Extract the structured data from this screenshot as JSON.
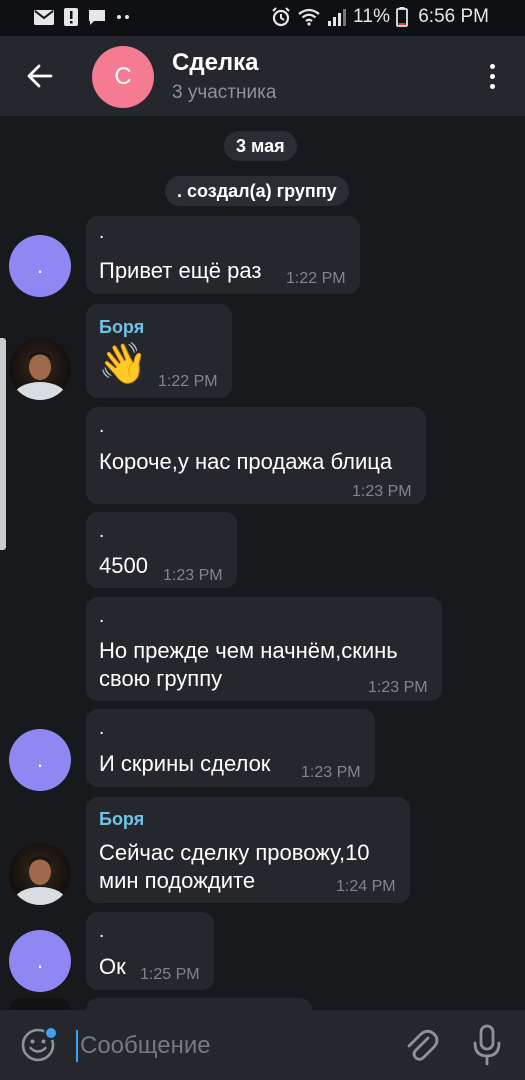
{
  "status_bar": {
    "battery": "11%",
    "time": "6:56 PM",
    "icons_left": [
      "mail-icon",
      "alert-icon",
      "chat-icon",
      "more-icon"
    ],
    "icons_right": [
      "alarm-icon",
      "wifi-icon",
      "signal-icon",
      "battery-icon"
    ]
  },
  "header": {
    "avatar_letter": "С",
    "title": "Сделка",
    "subtitle": "3 участника",
    "avatar_color": "#f47b91"
  },
  "chips": {
    "date": "3 мая",
    "created": ". создал(а) группу"
  },
  "messages": [
    {
      "sender": ".",
      "text": "Привет ещё раз",
      "time": "1:22 PM",
      "avatar": "dot"
    },
    {
      "sender": "Боря",
      "text": "👋",
      "time": "1:22 PM",
      "avatar": "photo"
    },
    {
      "sender": ".",
      "text": "Короче,у нас продажа блица",
      "time": "1:23 PM"
    },
    {
      "sender": ".",
      "text": "4500",
      "time": "1:23 PM"
    },
    {
      "sender": ".",
      "text_lines": [
        "Но прежде чем начнём,скинь",
        "свою группу"
      ],
      "time": "1:23 PM"
    },
    {
      "sender": ".",
      "text": "И скрины сделок",
      "time": "1:23 PM",
      "avatar": "dot"
    },
    {
      "sender": "Боря",
      "text_lines": [
        "Сейчас сделку провожу,10",
        "мин подождите"
      ],
      "time": "1:24 PM",
      "avatar": "photo"
    },
    {
      "sender": ".",
      "text": "Ок",
      "time": "1:25 PM",
      "avatar": "dot"
    }
  ],
  "avatar_dot_label": ".",
  "composer": {
    "placeholder": "Сообщение"
  },
  "colors": {
    "accent": "#3ea2ef",
    "sender_name": "#6ec3e6",
    "avatar_dot": "#8f87f2",
    "bubble": "#25272c",
    "background": "#18191d"
  }
}
